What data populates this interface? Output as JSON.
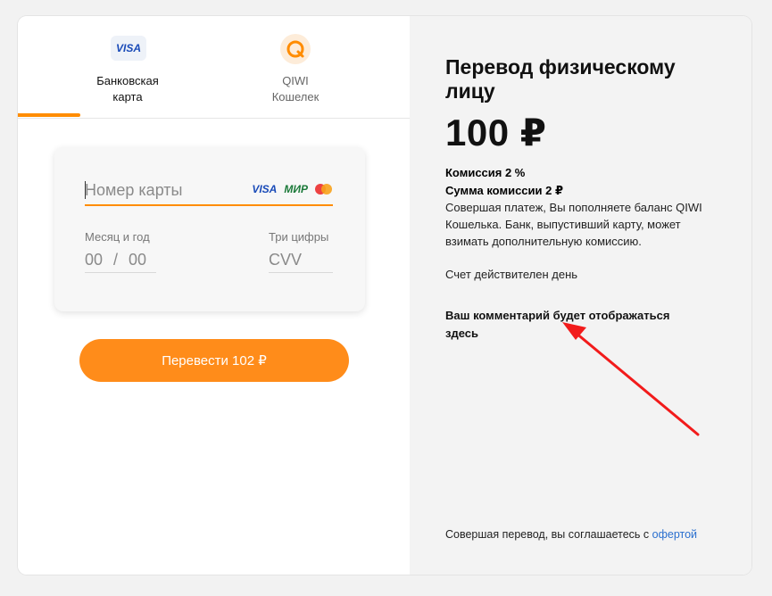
{
  "tabs": [
    {
      "label": "Банковская\nкарта",
      "icon": "visa-badge",
      "icon_text": "VISA",
      "active": true
    },
    {
      "label": "QIWI\nКошелек",
      "icon": "qiwi-logo-icon",
      "active": false
    }
  ],
  "form": {
    "card_number_placeholder": "Номер карты",
    "brands": {
      "visa": "VISA",
      "mir": "МИР",
      "mastercard": "mastercard-icon"
    },
    "expiry_label": "Месяц и год",
    "expiry_month_placeholder": "00",
    "expiry_separator": "/",
    "expiry_year_placeholder": "00",
    "cvv_label": "Три цифры",
    "cvv_placeholder": "CVV"
  },
  "submit_label": "Перевести 102 ₽",
  "summary": {
    "title": "Перевод физическому лицу",
    "amount": "100 ₽",
    "commission": "Комиссия 2 %",
    "commission_sum": "Сумма комиссии 2 ₽",
    "info": "Совершая платеж, Вы пополняете баланс QIWI Кошелька. Банк, выпустивший карту, может взимать дополнительную комиссию.",
    "validity": "Счет действителен день",
    "comment": "Ваш комментарий будет отображаться здесь",
    "footer_prefix": "Совершая перевод, вы соглашаетесь с ",
    "footer_link": "офертой"
  },
  "colors": {
    "accent": "#ff8c1a",
    "link": "#2a6fcf",
    "annotation_arrow": "#f21b1b",
    "right_pane_bg": "#f3f3f3"
  }
}
